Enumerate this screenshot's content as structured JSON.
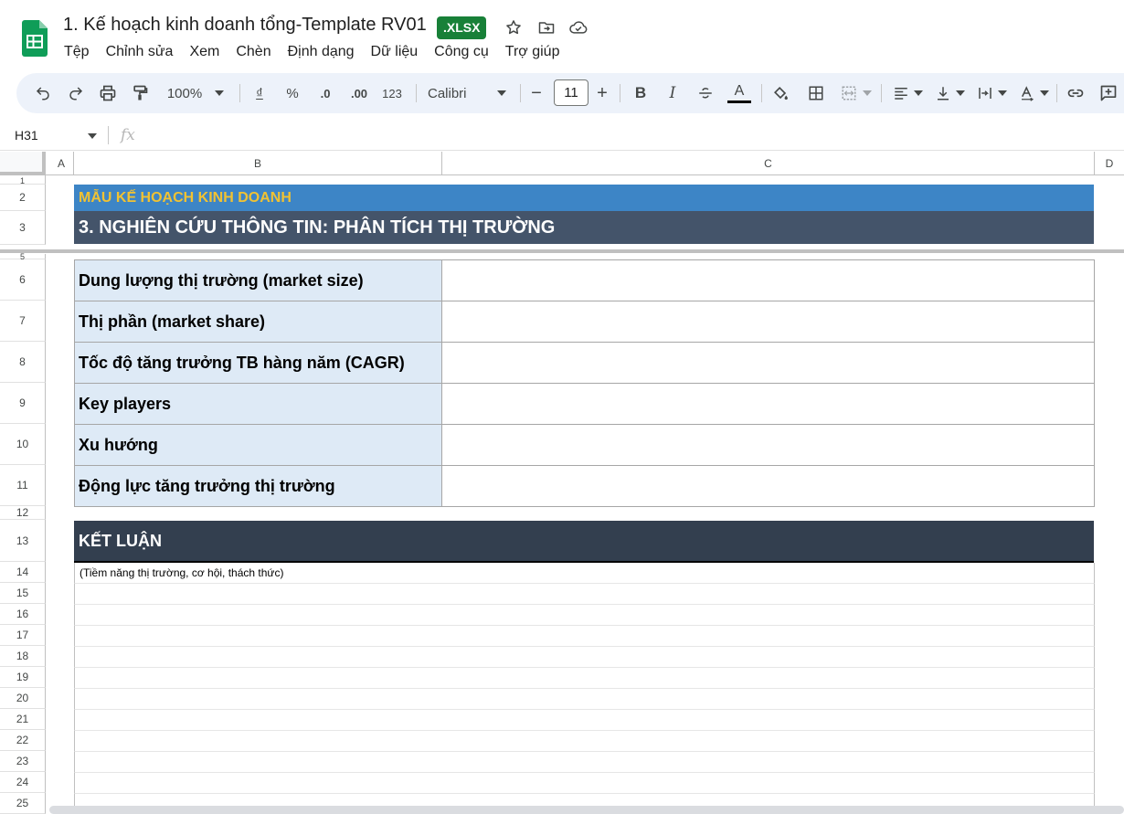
{
  "header": {
    "title": "1. Kế hoạch kinh doanh tổng-Template RV01",
    "badge": ".XLSX",
    "icons": [
      "star-icon",
      "move-to-folder-icon",
      "cloud-saved-icon"
    ]
  },
  "menu": [
    "Tệp",
    "Chỉnh sửa",
    "Xem",
    "Chèn",
    "Định dạng",
    "Dữ liệu",
    "Công cụ",
    "Trợ giúp"
  ],
  "toolbar": {
    "zoom": "100%",
    "currency_symbol": "₫",
    "percent_symbol": "%",
    "decrease_decimal": ".0",
    "increase_decimal": ".00",
    "number_format": "123",
    "font_family": "Calibri",
    "font_size": "11",
    "bold": "B",
    "italic": "I",
    "text_color_letter": "A"
  },
  "formula_bar": {
    "cell_ref": "H31",
    "fx": "fx",
    "value": ""
  },
  "columns": [
    "A",
    "B",
    "C",
    "D"
  ],
  "rows_visible": [
    "1",
    "2",
    "3",
    "5",
    "6",
    "7",
    "8",
    "9",
    "10",
    "11",
    "12",
    "13",
    "14",
    "15",
    "16",
    "17",
    "18",
    "19",
    "20",
    "21",
    "22",
    "23",
    "24",
    "25"
  ],
  "sheet": {
    "template_title": "MẪU KẾ HOẠCH KINH DOANH",
    "section_title": "3. NGHIÊN CỨU THÔNG TIN: PHÂN TÍCH THỊ TRƯỜNG",
    "metrics": [
      {
        "row": "6",
        "label": "Dung lượng thị trường (market size)",
        "value": ""
      },
      {
        "row": "7",
        "label": "Thị phần (market share)",
        "value": ""
      },
      {
        "row": "8",
        "label": "Tốc độ tăng trưởng TB hàng năm (CAGR)",
        "value": ""
      },
      {
        "row": "9",
        "label": "Key players",
        "value": ""
      },
      {
        "row": "10",
        "label": "Xu hướng",
        "value": ""
      },
      {
        "row": "11",
        "label": "Động lực tăng trưởng thị trường",
        "value": ""
      }
    ],
    "conclusion_title": "KẾT LUẬN",
    "conclusion_note": "(Tiềm năng thị trường, cơ hội, thách thức)"
  },
  "colors": {
    "badge_green": "#188038",
    "banner_blue": "#3d85c6",
    "banner_gold_text": "#f1c232",
    "banner_dark": "#44546a",
    "conclusion_dark": "#333f4f",
    "label_fill": "#deeaf6",
    "toolbar_bg": "#edf2fa"
  }
}
